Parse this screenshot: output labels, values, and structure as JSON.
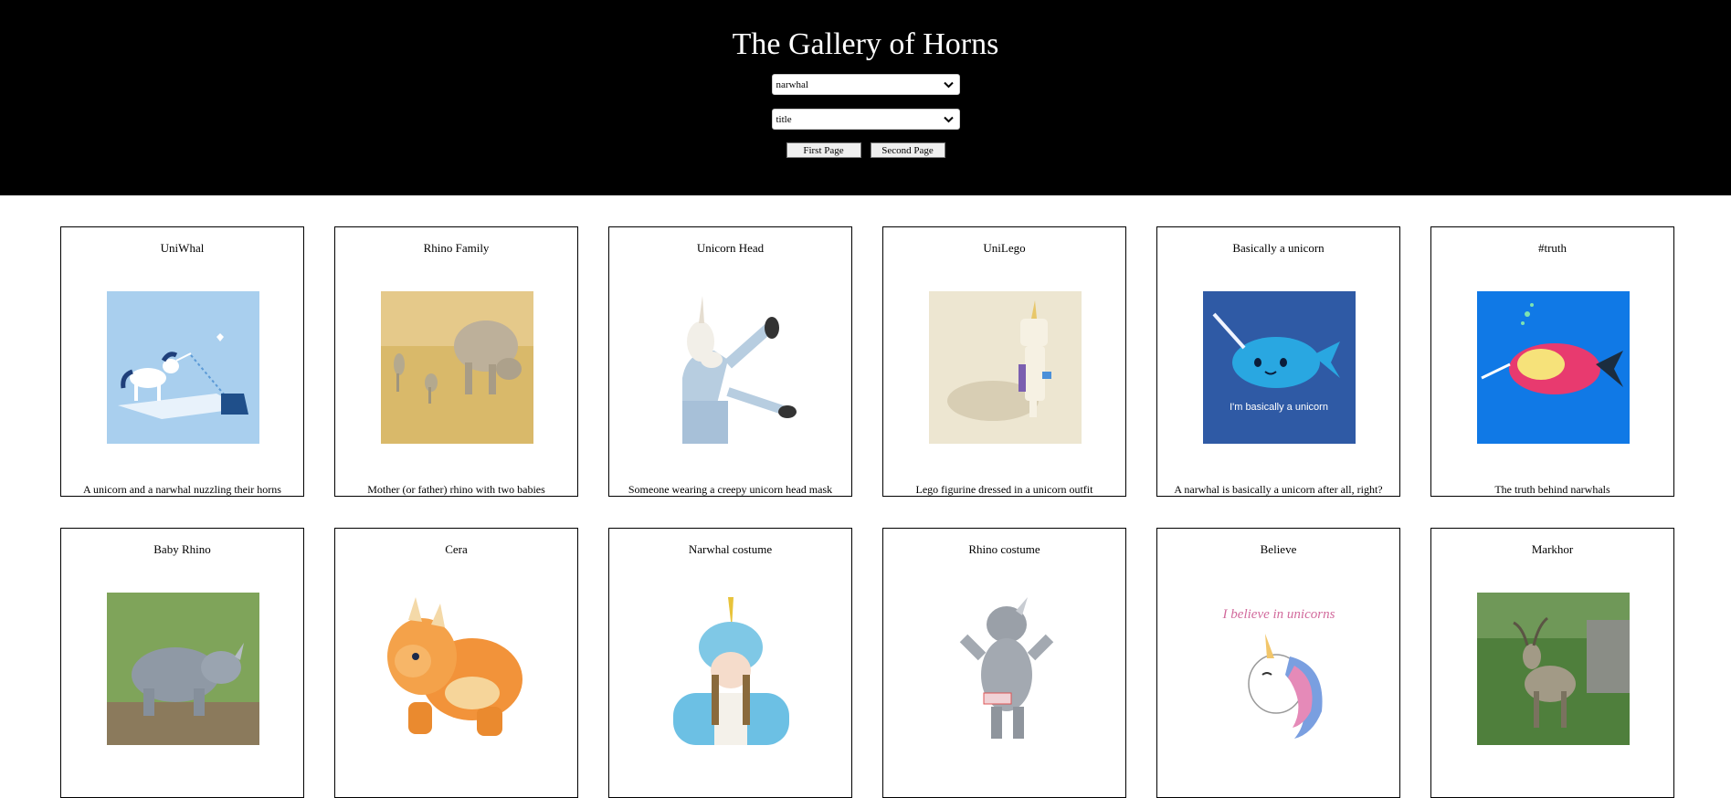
{
  "header": {
    "title": "The Gallery of Horns",
    "keyword_select": {
      "value": "narwhal"
    },
    "sort_select": {
      "value": "title"
    },
    "first_page_label": "First Page",
    "second_page_label": "Second Page"
  },
  "cards": [
    {
      "title": "UniWhal",
      "description": "A unicorn and a narwhal nuzzling their horns",
      "image": "unicorn-narwhal-illustration"
    },
    {
      "title": "Rhino Family",
      "description": "Mother (or father) rhino with two babies",
      "image": "rhino-family-photo"
    },
    {
      "title": "Unicorn Head",
      "description": "Someone wearing a creepy unicorn head mask",
      "image": "unicorn-mask-photo"
    },
    {
      "title": "UniLego",
      "description": "Lego figurine dressed in a unicorn outfit",
      "image": "lego-unicorn-photo"
    },
    {
      "title": "Basically a unicorn",
      "description": "A narwhal is basically a unicorn after all, right?",
      "image": "narwhal-cartoon",
      "image_text": "I'm basically a unicorn"
    },
    {
      "title": "#truth",
      "description": "The truth behind narwhals",
      "image": "narwhal-truth-illustration"
    },
    {
      "title": "Baby Rhino",
      "description": "",
      "image": "baby-rhino-photo"
    },
    {
      "title": "Cera",
      "description": "",
      "image": "triceratops-cartoon"
    },
    {
      "title": "Narwhal costume",
      "description": "",
      "image": "narwhal-costume-photo"
    },
    {
      "title": "Rhino costume",
      "description": "",
      "image": "rhino-costume-photo"
    },
    {
      "title": "Believe",
      "description": "",
      "image": "believe-unicorn-illustration",
      "image_text": "I believe in unicorns"
    },
    {
      "title": "Markhor",
      "description": "",
      "image": "markhor-photo"
    }
  ]
}
